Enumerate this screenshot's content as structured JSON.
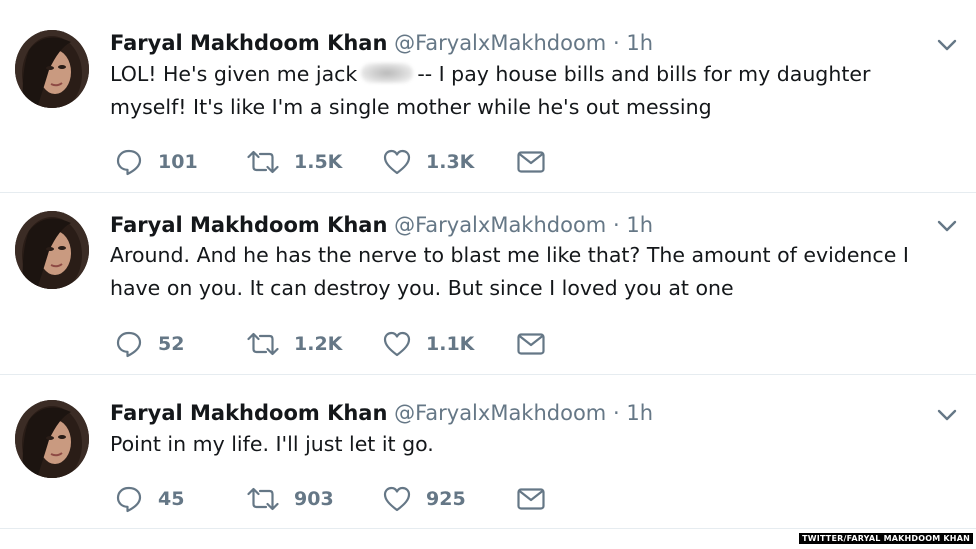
{
  "tweets": [
    {
      "name": "Faryal Makhdoom Khan",
      "handle": "@FaryalxMakhdoom",
      "separator": "·",
      "time": "1h",
      "text_before": "LOL! He's given me jack",
      "text_after": "-- I pay house bills and bills for my daughter myself! It's like I'm a single mother while he's out messing",
      "replies": "101",
      "retweets": "1.5K",
      "likes": "1.3K"
    },
    {
      "name": "Faryal Makhdoom Khan",
      "handle": "@FaryalxMakhdoom",
      "separator": "·",
      "time": "1h",
      "text": "Around. And he has the nerve to blast me like that? The amount of evidence I have on you. It can destroy you. But since I loved you at one",
      "replies": "52",
      "retweets": "1.2K",
      "likes": "1.1K"
    },
    {
      "name": "Faryal Makhdoom Khan",
      "handle": "@FaryalxMakhdoom",
      "separator": "·",
      "time": "1h",
      "text": "Point in my life. I'll just let it go.",
      "replies": "45",
      "retweets": "903",
      "likes": "925"
    }
  ],
  "icons": {
    "reply": "reply-icon",
    "retweet": "retweet-icon",
    "like": "heart-icon",
    "dm": "envelope-icon",
    "menu": "chevron-down-icon"
  },
  "colors": {
    "text": "#14171a",
    "secondary": "#657786",
    "divider": "#e6ecf0"
  },
  "credit": "TWITTER/FARYAL MAKHDOOM KHAN"
}
